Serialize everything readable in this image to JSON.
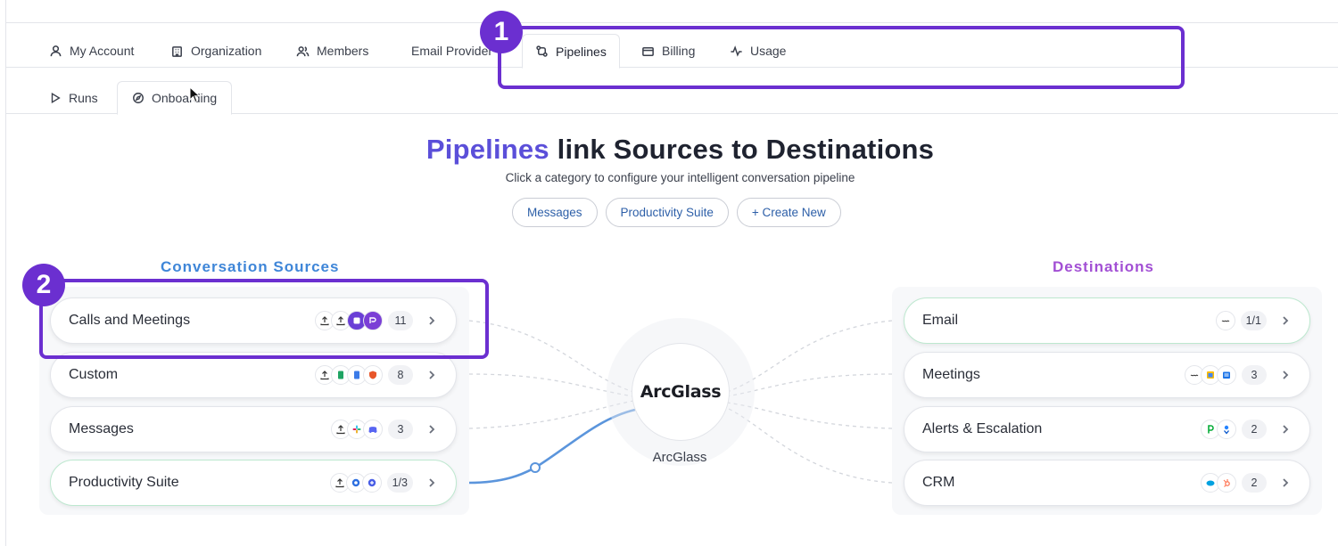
{
  "tabs": [
    {
      "label": "My Account",
      "icon": "user-icon"
    },
    {
      "label": "Organization",
      "icon": "building-icon"
    },
    {
      "label": "Members",
      "icon": "users-icon"
    },
    {
      "label": "Email Provider",
      "icon": "mail-icon"
    },
    {
      "label": "Pipelines",
      "icon": "pipelines-icon",
      "active": true
    },
    {
      "label": "Billing",
      "icon": "card-icon"
    },
    {
      "label": "Usage",
      "icon": "activity-icon"
    }
  ],
  "subtabs": [
    {
      "label": "Runs",
      "icon": "play-icon"
    },
    {
      "label": "Onboarding",
      "icon": "compass-icon",
      "active": true
    }
  ],
  "hero": {
    "accent": "Pipelines",
    "rest": " link Sources to Destinations",
    "subtitle": "Click a category to configure your intelligent conversation pipeline"
  },
  "chips": [
    "Messages",
    "Productivity Suite",
    "+ Create New"
  ],
  "sources": {
    "title": "Conversation Sources",
    "items": [
      {
        "name": "Calls and Meetings",
        "count": "11"
      },
      {
        "name": "Custom",
        "count": "8"
      },
      {
        "name": "Messages",
        "count": "3"
      },
      {
        "name": "Productivity Suite",
        "count": "1/3"
      }
    ]
  },
  "destinations": {
    "title": "Destinations",
    "items": [
      {
        "name": "Email",
        "count": "1/1"
      },
      {
        "name": "Meetings",
        "count": "3"
      },
      {
        "name": "Alerts & Escalation",
        "count": "2"
      },
      {
        "name": "CRM",
        "count": "2"
      }
    ]
  },
  "hub": {
    "logo": "ArcGlass",
    "label": "ArcGlass"
  },
  "annotations": {
    "one": "1",
    "two": "2"
  },
  "colors": {
    "accent": "#5b4fd9",
    "sources": "#3f86d8",
    "destinations": "#a24fd4",
    "annotation": "#6b2fd0",
    "connector": "#5b95dc"
  }
}
